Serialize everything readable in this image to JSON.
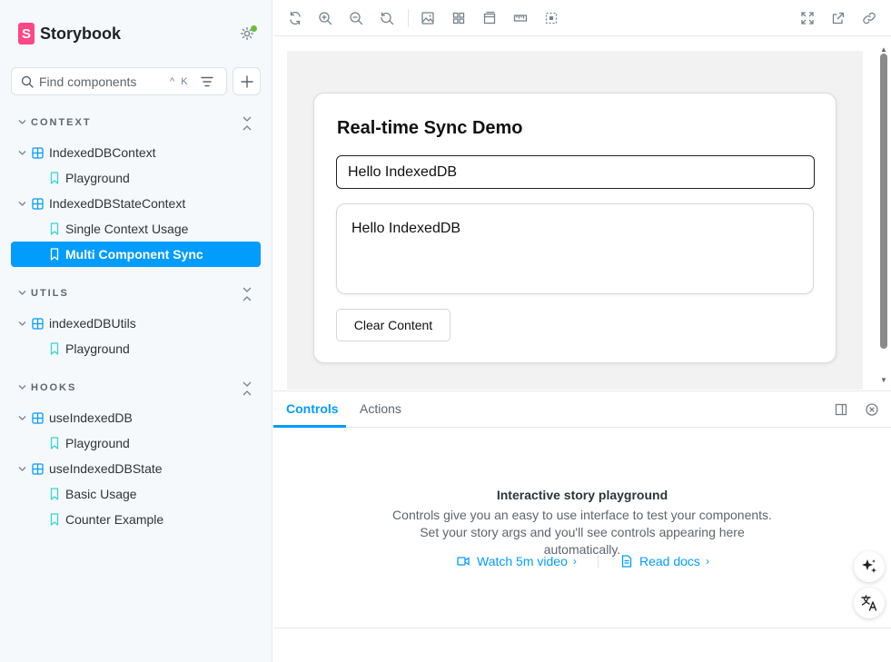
{
  "brand": {
    "name": "Storybook",
    "logo_letter": "S"
  },
  "search": {
    "placeholder": "Find components",
    "shortcut": "^ K"
  },
  "sections": [
    {
      "title": "CONTEXT"
    },
    {
      "title": "UTILS"
    },
    {
      "title": "HOOKS"
    }
  ],
  "tree": {
    "c0": "IndexedDBContext",
    "c0s0": "Playground",
    "c1": "IndexedDBStateContext",
    "c1s0": "Single Context Usage",
    "c1s1": "Multi Component Sync",
    "c2": "indexedDBUtils",
    "c2s0": "Playground",
    "c3": "useIndexedDB",
    "c3s0": "Playground",
    "c4": "useIndexedDBState",
    "c4s0": "Basic Usage",
    "c4s1": "Counter Example"
  },
  "story": {
    "title": "Real-time Sync Demo",
    "input_value": "Hello IndexedDB",
    "display_text": "Hello IndexedDB",
    "clear_label": "Clear Content"
  },
  "panel": {
    "tabs": [
      "Controls",
      "Actions"
    ],
    "empty_title": "Interactive story playground",
    "empty_desc": "Controls give you an easy to use interface to test your components. Set your story args and you'll see controls appearing here automatically.",
    "video_link": "Watch 5m video",
    "docs_link": "Read docs"
  },
  "colors": {
    "accent": "#029cfd",
    "brand": "#ff4785",
    "status": "#66bf3c"
  }
}
